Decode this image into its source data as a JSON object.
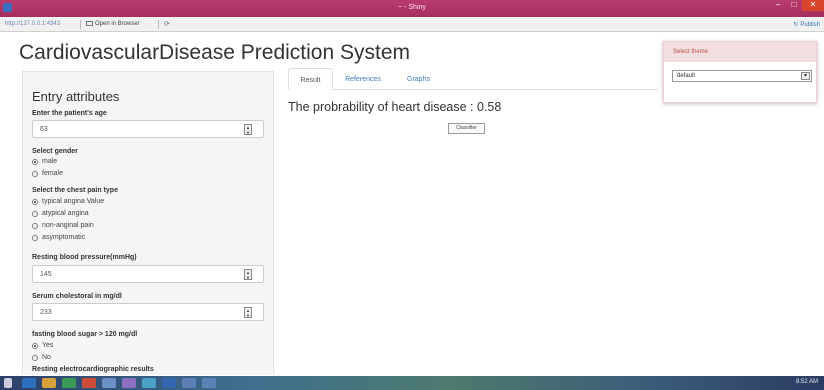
{
  "window": {
    "title": "~ - Shiny",
    "minimize": "–",
    "maximize": "□",
    "close": "✕"
  },
  "toolbar": {
    "url": "http://127.0.0.1:4343",
    "open_in_browser": "Open in Browser",
    "refresh": "⟳",
    "publish": "Publish"
  },
  "page": {
    "title": "CardiovascularDisease Prediction System"
  },
  "sidebar": {
    "heading": "Entry attributes",
    "age": {
      "label": "Enter the patient's age",
      "value": "63"
    },
    "gender": {
      "label": "Select gender",
      "options": [
        "male",
        "female"
      ],
      "selected": 0
    },
    "chest_pain": {
      "label": "Select the chest pain type",
      "options": [
        "typical angina Value",
        "atypical angina",
        "non-anginal pain",
        "asymptomatic"
      ],
      "selected": 0
    },
    "bp": {
      "label": "Resting blood pressure(mmHg)",
      "value": "145"
    },
    "chol": {
      "label": "Serum cholestoral in mg/dl",
      "value": "233"
    },
    "fbs": {
      "label": "fasting blood sugar > 120 mg/dl",
      "options": [
        "Yes",
        "No"
      ],
      "selected": 0
    },
    "ecg": {
      "label": "Resting electrocardiographic results"
    }
  },
  "tabs": [
    {
      "label": "Result"
    },
    {
      "label": "References"
    },
    {
      "label": "Graphs"
    }
  ],
  "result": {
    "text": "The probrability of heart disease : 0.58",
    "button": "Classifier"
  },
  "theme": {
    "title": "Select theme",
    "value": "default"
  },
  "taskbar": {
    "time": "8:52 AM"
  },
  "colors": {
    "titlebar": "#b83b6c",
    "link": "#3a7bbf",
    "theme_header_bg": "#f2dede",
    "theme_header_text": "#b94a48"
  }
}
